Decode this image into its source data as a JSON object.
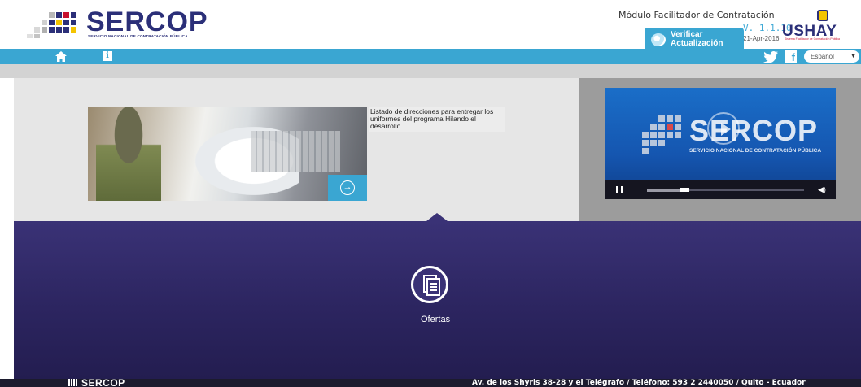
{
  "header": {
    "logo_text": "SERCOP",
    "logo_subtitle": "SERVICIO NACIONAL DE CONTRATACIÓN PÚBLICA",
    "module_title": "Módulo Facilitador de Contratación",
    "version": "V. 1.1.10",
    "date": "21-Apr-2016",
    "verify_button": {
      "line1": "Verificar",
      "line2": "Actualización"
    },
    "partner_logo": "USHAY",
    "partner_subtitle": "Sistema Facilitador de Contratación Pública"
  },
  "nav": {
    "home_icon": "home-icon",
    "info_icon": "info-icon",
    "info_glyph": "i",
    "twitter_icon": "twitter-icon",
    "facebook_icon": "facebook-icon",
    "facebook_glyph": "f",
    "language": "Español",
    "language_arrow": "▼"
  },
  "hero": {
    "caption": "Listado de direcciones para entregar los uniformes del programa Hilando el desarrollo",
    "arrow_glyph": "→"
  },
  "video": {
    "title_text": "SERCOP",
    "subtitle_text": "SERVICIO NACIONAL DE CONTRATACIÓN PÚBLICA",
    "progress": 0.27,
    "volume_glyph": "◀)"
  },
  "main": {
    "ofertas_label": "Ofertas"
  },
  "footer": {
    "logo_text": "SERCOP",
    "address": "Av. de los Shyris 38-28 y el Telégrafo / Teléfono: 593 2 2440050 / Quito - Ecuador"
  },
  "colors": {
    "accent_blue": "#3aa6d2",
    "brand_navy": "#2b2f78",
    "dark_section": "#2c2560"
  }
}
